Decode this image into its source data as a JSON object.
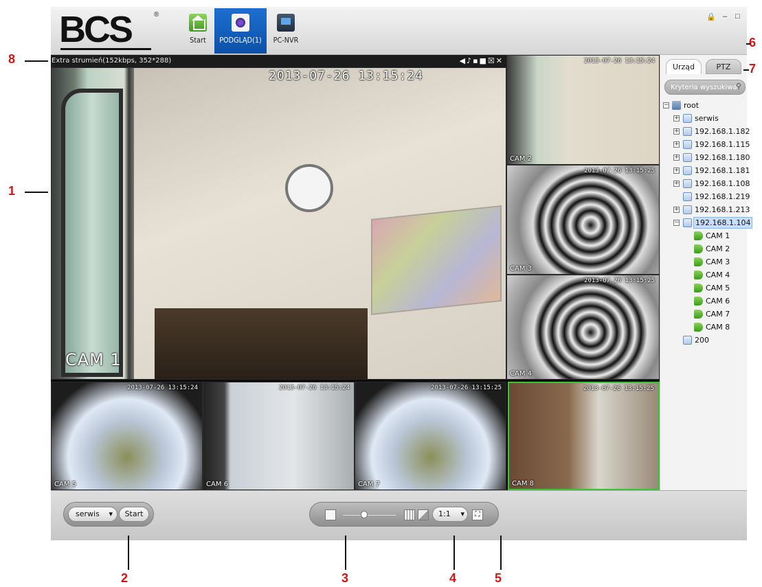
{
  "app": {
    "logo_text": "BCS",
    "logo_mark": "®",
    "nav_tabs": [
      {
        "label": "Start",
        "icon": "home-icon"
      },
      {
        "label": "PODGLĄD(1)",
        "icon": "camera-icon",
        "active": true
      },
      {
        "label": "PC-NVR",
        "icon": "nvr-icon"
      }
    ],
    "window_controls": {
      "lock": "🔒",
      "minimize": "–",
      "maximize": "□"
    }
  },
  "video": {
    "info_text": "Extra strumień(152kbps, 352*288)",
    "tools": "◀♪▪■☒✕",
    "main_timestamp": "2013-07-26 13:15:24",
    "cameras": [
      {
        "label": "CAM 1",
        "timestamp": ""
      },
      {
        "label": "CAM 2",
        "timestamp": "2013-07-26 13:15:24"
      },
      {
        "label": "CAM 3",
        "timestamp": "2013-07-26 13:15:25"
      },
      {
        "label": "CAM 4",
        "timestamp": "2013-07-26 13:15:25"
      },
      {
        "label": "CAM 5",
        "timestamp": "2013-07-26 13:15:24"
      },
      {
        "label": "CAM 6",
        "timestamp": "2013-07-26 13:15:24"
      },
      {
        "label": "CAM 7",
        "timestamp": "2013-07-26 13:15:25"
      },
      {
        "label": "CAM 8",
        "timestamp": "2013-07-26 13:15:25"
      }
    ]
  },
  "panel": {
    "tabs": [
      "Urząd",
      "PTZ"
    ],
    "search_placeholder": "Kryteria wyszukiwania",
    "tree": [
      {
        "label": "root",
        "expander": "−"
      },
      {
        "label": "serwis",
        "expander": "+"
      },
      {
        "label": "192.168.1.182",
        "expander": "+"
      },
      {
        "label": "192.168.1.115",
        "expander": "+"
      },
      {
        "label": "192.168.1.180",
        "expander": "+"
      },
      {
        "label": "192.168.1.181",
        "expander": "+"
      },
      {
        "label": "192.168.1.108",
        "expander": "+"
      },
      {
        "label": "192.168.1.219",
        "expander": ""
      },
      {
        "label": "192.168.1.213",
        "expander": "+"
      },
      {
        "label": "192.168.1.104",
        "expander": "−"
      },
      {
        "label": "CAM 1"
      },
      {
        "label": "CAM 2"
      },
      {
        "label": "CAM 3"
      },
      {
        "label": "CAM 4"
      },
      {
        "label": "CAM 5"
      },
      {
        "label": "CAM 6"
      },
      {
        "label": "CAM 7"
      },
      {
        "label": "CAM 8"
      },
      {
        "label": "200",
        "expander": ""
      }
    ]
  },
  "toolbar": {
    "profile_value": "serwis",
    "dropdown_arrow": "▾",
    "start_label": "Start",
    "ratio_value": "1:1",
    "ratio_arrow": "▾"
  },
  "annotations": [
    "1",
    "2",
    "3",
    "4",
    "5",
    "6",
    "7",
    "8"
  ],
  "colors": {
    "accent": "#0b50a8",
    "annotation": "#d51414",
    "selected_cam_border": "#35c735"
  }
}
